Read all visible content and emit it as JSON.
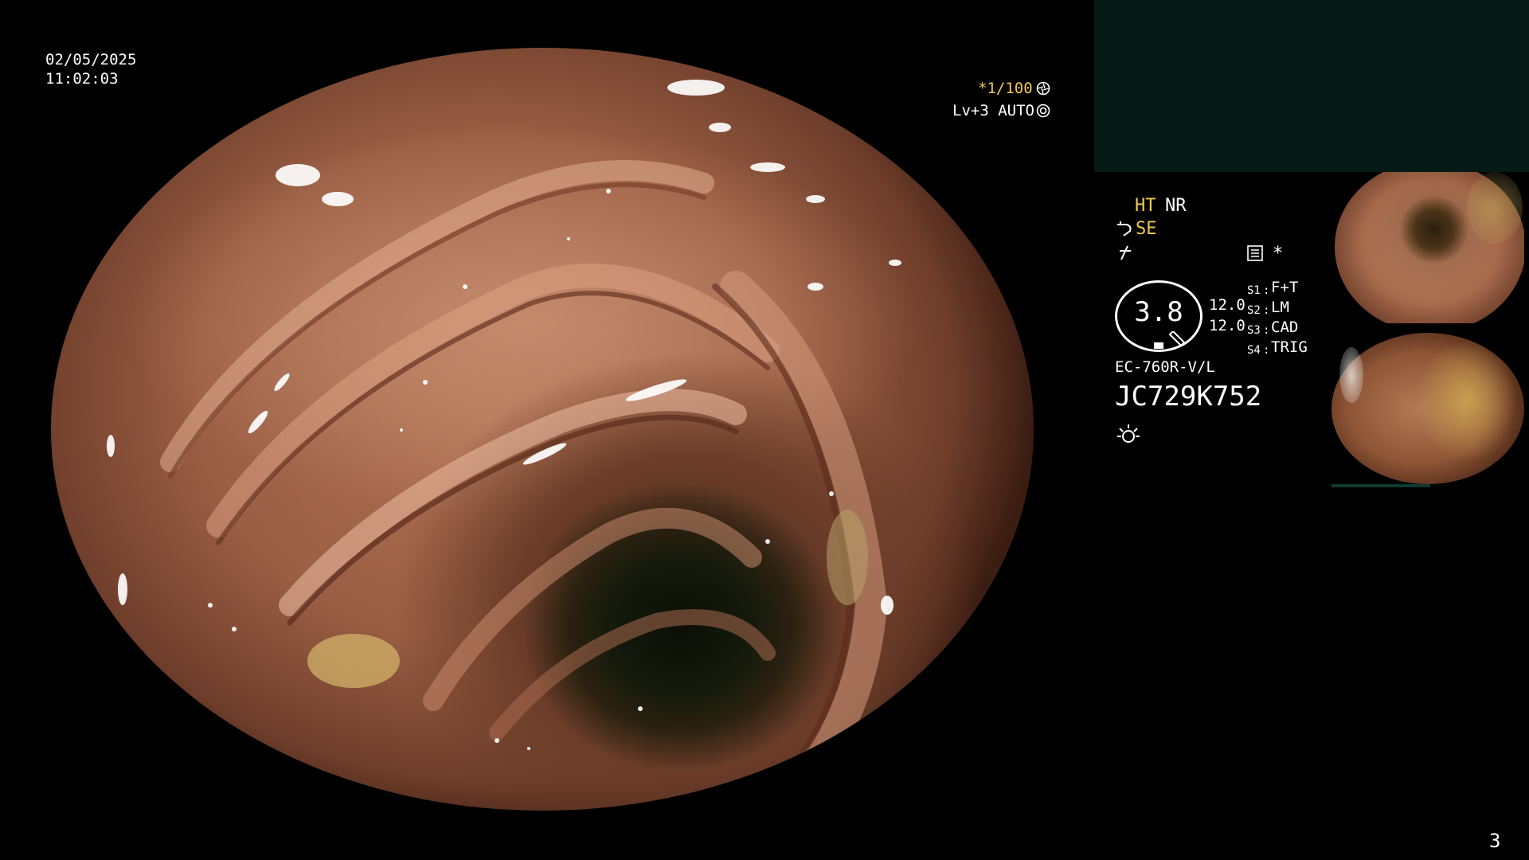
{
  "header": {
    "date": "02/05/2025",
    "time": "11:02:03"
  },
  "scope_settings": {
    "shutter": "*1/100",
    "shutter_icon": "aperture-icon",
    "level": "Lv+3 AUTO",
    "level_icon": "iris-icon"
  },
  "image_modes": {
    "ht": "HT",
    "nr": "NR",
    "se": "SE",
    "se_icon": "pointer-hand-icon",
    "freeze_icon": "lightning-icon",
    "menu_icon": "settings-card-icon",
    "asterisk": "*"
  },
  "brightness": {
    "value": "3.8",
    "gain_top": "12.0",
    "gain_bottom": "12.0"
  },
  "switches": [
    {
      "id": "S1",
      "value": "F+T"
    },
    {
      "id": "S2",
      "value": "LM"
    },
    {
      "id": "S3",
      "value": "CAD"
    },
    {
      "id": "S4",
      "value": "TRIG"
    }
  ],
  "device": {
    "model": "EC-760R-V/L",
    "serial": "JC729K752",
    "light_icon": "sun-icon"
  },
  "page_number": "3",
  "colors": {
    "background": "#000000",
    "overlay_text": "#ffffff",
    "highlight_text": "#f2c94c",
    "info_panel": "#061a16"
  }
}
